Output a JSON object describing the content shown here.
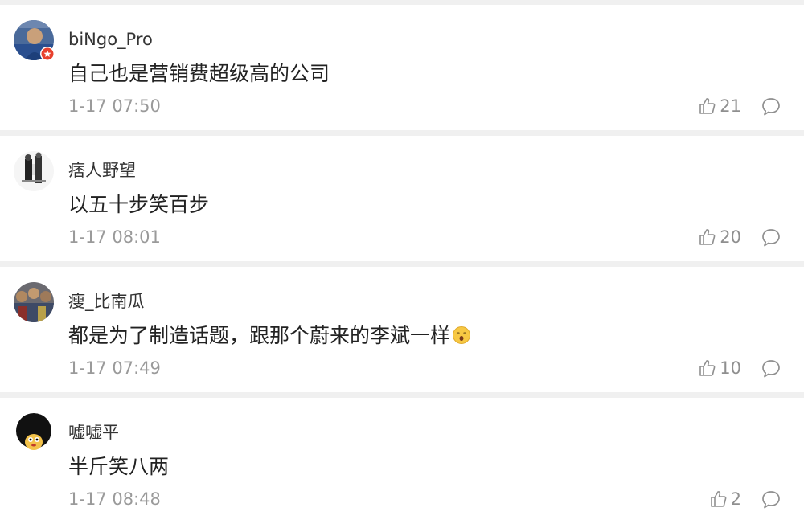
{
  "comments": [
    {
      "username": "biNgo_Pro",
      "text": "自己也是营销费超级高的公司",
      "time": "1-17 07:50",
      "likes": "21",
      "avatar_icon": "avatar-person-blue-shirt",
      "badge_icon": "verified-badge-icon"
    },
    {
      "username": "痞人野望",
      "text": "以五十步笑百步",
      "time": "1-17 08:01",
      "likes": "20",
      "avatar_icon": "avatar-black-white-figure"
    },
    {
      "username": "瘦_比南瓜",
      "text": "都是为了制造话题，跟那个蔚来的李斌一样",
      "emoji": "yawn-emoji",
      "time": "1-17 07:49",
      "likes": "10",
      "avatar_icon": "avatar-crowd-photo"
    },
    {
      "username": "嘘嘘平",
      "text": "半斤笑八两",
      "time": "1-17 08:48",
      "likes": "2",
      "avatar_icon": "avatar-afro-cartoon"
    }
  ],
  "colors": {
    "background": "#f0f0f0",
    "card": "#ffffff",
    "username": "#333333",
    "text": "#222222",
    "meta": "#9a9a9a"
  }
}
